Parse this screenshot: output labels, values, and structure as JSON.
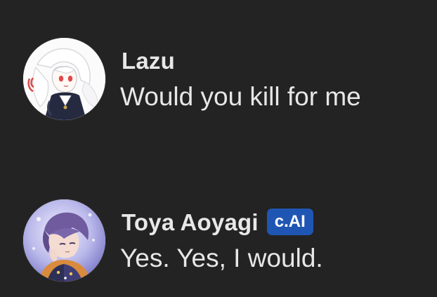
{
  "messages": [
    {
      "author": "Lazu",
      "text": "Would you kill for me",
      "avatar_icon": "anime-avatar-white-hair-icon",
      "badge": ""
    },
    {
      "author": "Toya Aoyagi",
      "text": "Yes. Yes, I would.",
      "avatar_icon": "anime-avatar-purple-hair-icon",
      "badge": "c.AI"
    }
  ],
  "colors": {
    "background": "#232323",
    "text": "#e7e7e7",
    "badge_background": "#1f56b3",
    "badge_text": "#ffffff"
  }
}
